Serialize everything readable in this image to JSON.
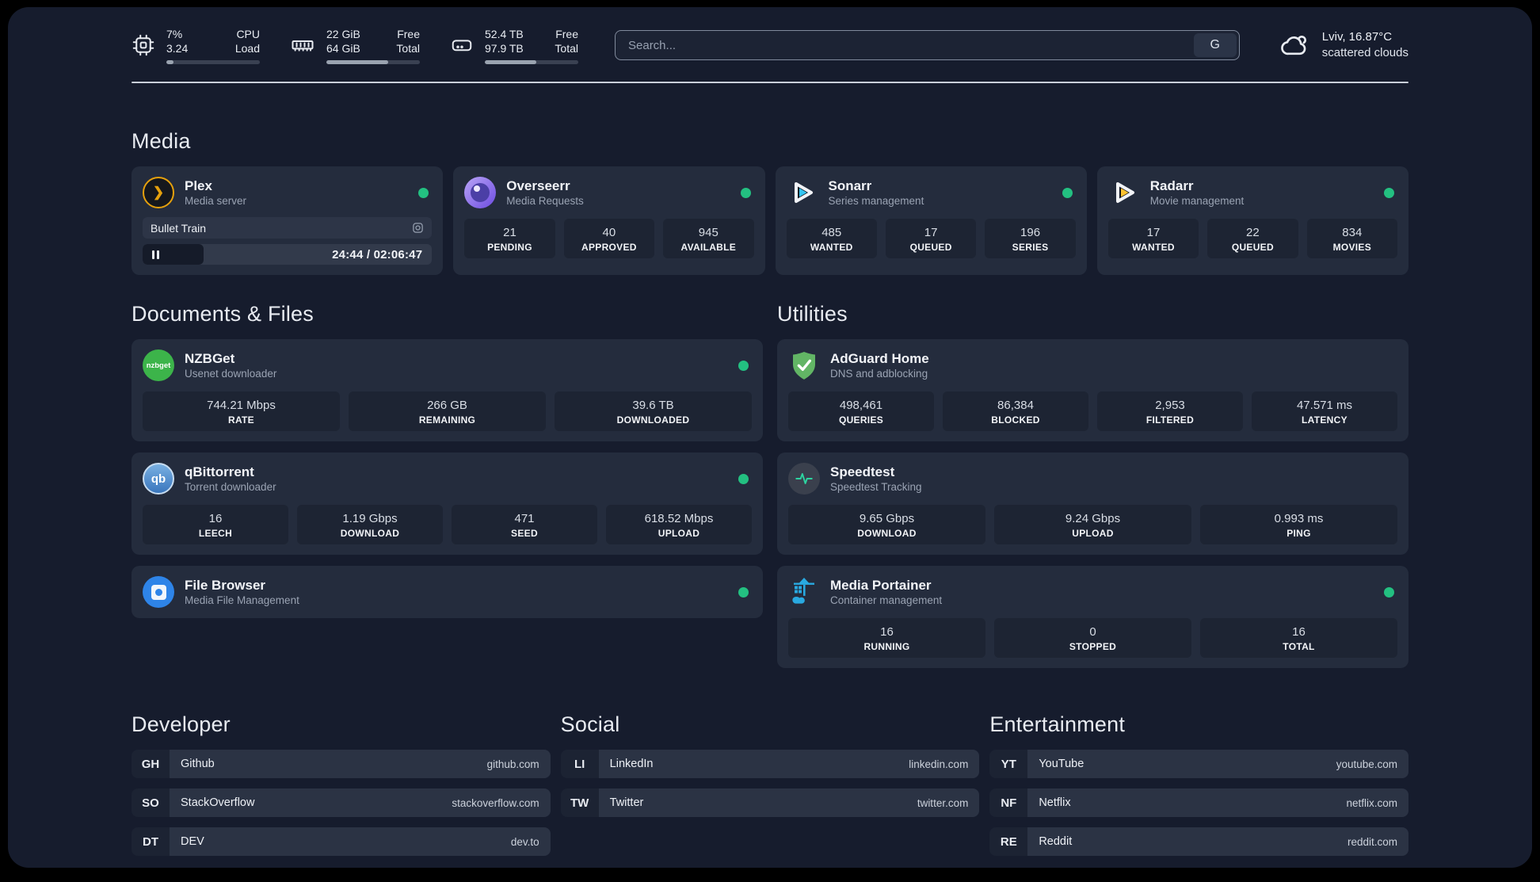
{
  "colors": {
    "status-green": "#23c081",
    "plex-amber": "#e5a00d",
    "sonarr-cyan": "#35c5f1",
    "radarr-amber": "#ffc230",
    "nzbget-green": "#3cb44a",
    "adguard-green": "#62b565",
    "speedtest-green": "#2dd4a0",
    "filebrowser-blue": "#2e84e8",
    "portainer-blue": "#29a9e0"
  },
  "topbar": {
    "stats": [
      {
        "icon": "cpu-icon",
        "value_top": "7%",
        "value_bottom": "3.24",
        "label_top": "CPU",
        "label_bottom": "Load",
        "progress": 8
      },
      {
        "icon": "ram-icon",
        "value_top": "22 GiB",
        "value_bottom": "64 GiB",
        "label_top": "Free",
        "label_bottom": "Total",
        "progress": 66
      },
      {
        "icon": "disk-icon",
        "value_top": "52.4 TB",
        "value_bottom": "97.9 TB",
        "label_top": "Free",
        "label_bottom": "Total",
        "progress": 55
      }
    ],
    "search": {
      "placeholder": "Search...",
      "engine": "G"
    },
    "weather": {
      "title": "Lviv, 16.87°C",
      "subtitle": "scattered clouds"
    }
  },
  "media": {
    "heading": "Media",
    "plex": {
      "title": "Plex",
      "subtitle": "Media server",
      "now_playing": "Bullet Train",
      "time": "24:44 / 02:06:47"
    },
    "overseerr": {
      "title": "Overseerr",
      "subtitle": "Media Requests",
      "stats": [
        {
          "value": "21",
          "label": "PENDING"
        },
        {
          "value": "40",
          "label": "APPROVED"
        },
        {
          "value": "945",
          "label": "AVAILABLE"
        }
      ]
    },
    "sonarr": {
      "title": "Sonarr",
      "subtitle": "Series management",
      "stats": [
        {
          "value": "485",
          "label": "WANTED"
        },
        {
          "value": "17",
          "label": "QUEUED"
        },
        {
          "value": "196",
          "label": "SERIES"
        }
      ]
    },
    "radarr": {
      "title": "Radarr",
      "subtitle": "Movie management",
      "stats": [
        {
          "value": "17",
          "label": "WANTED"
        },
        {
          "value": "22",
          "label": "QUEUED"
        },
        {
          "value": "834",
          "label": "MOVIES"
        }
      ]
    }
  },
  "documents": {
    "heading": "Documents & Files",
    "nzbget": {
      "title": "NZBGet",
      "subtitle": "Usenet downloader",
      "icon_text": "nzbget",
      "stats": [
        {
          "value": "744.21 Mbps",
          "label": "RATE"
        },
        {
          "value": "266 GB",
          "label": "REMAINING"
        },
        {
          "value": "39.6 TB",
          "label": "DOWNLOADED"
        }
      ]
    },
    "qbittorrent": {
      "title": "qBittorrent",
      "subtitle": "Torrent downloader",
      "icon_text": "qb",
      "stats": [
        {
          "value": "16",
          "label": "LEECH"
        },
        {
          "value": "1.19 Gbps",
          "label": "DOWNLOAD"
        },
        {
          "value": "471",
          "label": "SEED"
        },
        {
          "value": "618.52 Mbps",
          "label": "UPLOAD"
        }
      ]
    },
    "filebrowser": {
      "title": "File Browser",
      "subtitle": "Media File Management"
    }
  },
  "utilities": {
    "heading": "Utilities",
    "adguard": {
      "title": "AdGuard Home",
      "subtitle": "DNS and adblocking",
      "stats": [
        {
          "value": "498,461",
          "label": "QUERIES"
        },
        {
          "value": "86,384",
          "label": "BLOCKED"
        },
        {
          "value": "2,953",
          "label": "FILTERED"
        },
        {
          "value": "47.571 ms",
          "label": "LATENCY"
        }
      ]
    },
    "speedtest": {
      "title": "Speedtest",
      "subtitle": "Speedtest Tracking",
      "stats": [
        {
          "value": "9.65 Gbps",
          "label": "DOWNLOAD"
        },
        {
          "value": "9.24 Gbps",
          "label": "UPLOAD"
        },
        {
          "value": "0.993 ms",
          "label": "PING"
        }
      ]
    },
    "portainer": {
      "title": "Media Portainer",
      "subtitle": "Container management",
      "stats": [
        {
          "value": "16",
          "label": "RUNNING"
        },
        {
          "value": "0",
          "label": "STOPPED"
        },
        {
          "value": "16",
          "label": "TOTAL"
        }
      ]
    }
  },
  "bookmarks": [
    {
      "heading": "Developer",
      "items": [
        {
          "abbr": "GH",
          "name": "Github",
          "url": "github.com"
        },
        {
          "abbr": "SO",
          "name": "StackOverflow",
          "url": "stackoverflow.com"
        },
        {
          "abbr": "DT",
          "name": "DEV",
          "url": "dev.to"
        }
      ]
    },
    {
      "heading": "Social",
      "items": [
        {
          "abbr": "LI",
          "name": "LinkedIn",
          "url": "linkedin.com"
        },
        {
          "abbr": "TW",
          "name": "Twitter",
          "url": "twitter.com"
        }
      ]
    },
    {
      "heading": "Entertainment",
      "items": [
        {
          "abbr": "YT",
          "name": "YouTube",
          "url": "youtube.com"
        },
        {
          "abbr": "NF",
          "name": "Netflix",
          "url": "netflix.com"
        },
        {
          "abbr": "RE",
          "name": "Reddit",
          "url": "reddit.com"
        }
      ]
    }
  ]
}
